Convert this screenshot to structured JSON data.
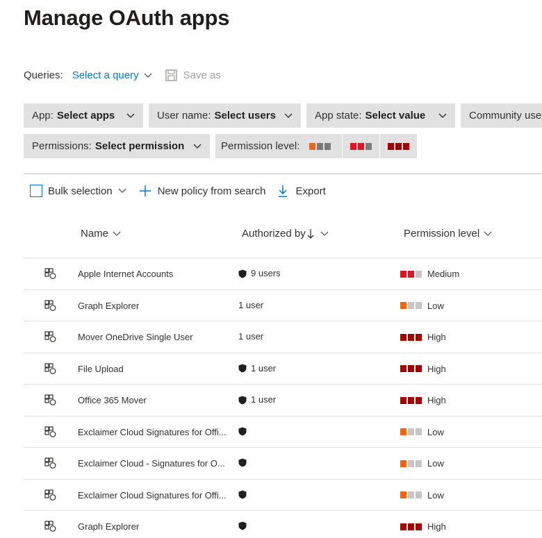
{
  "page": {
    "title": "Manage OAuth apps"
  },
  "queries": {
    "label": "Queries:",
    "select_label": "Select a query",
    "save_label": "Save as"
  },
  "filters": {
    "app": {
      "label": "App:",
      "value": "Select apps"
    },
    "user": {
      "label": "User name:",
      "value": "Select users"
    },
    "state": {
      "label": "App state:",
      "value": "Select value"
    },
    "community": {
      "label": "Community use"
    },
    "permissions": {
      "label": "Permissions:",
      "value": "Select permission"
    },
    "permission_level": {
      "label": "Permission level:"
    }
  },
  "toolbar": {
    "bulk_label": "Bulk selection",
    "new_policy_label": "New policy from search",
    "export_label": "Export"
  },
  "columns": {
    "name": "Name",
    "authorized_by": "Authorized by",
    "permission_level": "Permission level"
  },
  "colors": {
    "accent": "#0078d4",
    "low": "#f7630c",
    "medium": "#e81123",
    "high": "#a80000",
    "empty": "#c8c6c4"
  },
  "level_labels": {
    "low": "Low",
    "medium": "Medium",
    "high": "High"
  },
  "rows": [
    {
      "name": "Apple Internet Accounts",
      "shield": true,
      "users": "9 users",
      "level": "medium"
    },
    {
      "name": "Graph Explorer",
      "shield": false,
      "users": "1 user",
      "level": "low"
    },
    {
      "name": "Mover OneDrive Single User",
      "shield": false,
      "users": "1 user",
      "level": "high"
    },
    {
      "name": "File Upload",
      "shield": true,
      "users": "1 user",
      "level": "high"
    },
    {
      "name": "Office 365 Mover",
      "shield": true,
      "users": "1 user",
      "level": "high"
    },
    {
      "name": "Exclaimer Cloud Signatures for Offi...",
      "shield": true,
      "users": "",
      "level": "low"
    },
    {
      "name": "Exclaimer Cloud - Signatures for O...",
      "shield": true,
      "users": "",
      "level": "low"
    },
    {
      "name": "Exclaimer Cloud Signatures for Offi...",
      "shield": true,
      "users": "",
      "level": "low"
    },
    {
      "name": "Graph Explorer",
      "shield": true,
      "users": "",
      "level": "high"
    }
  ]
}
